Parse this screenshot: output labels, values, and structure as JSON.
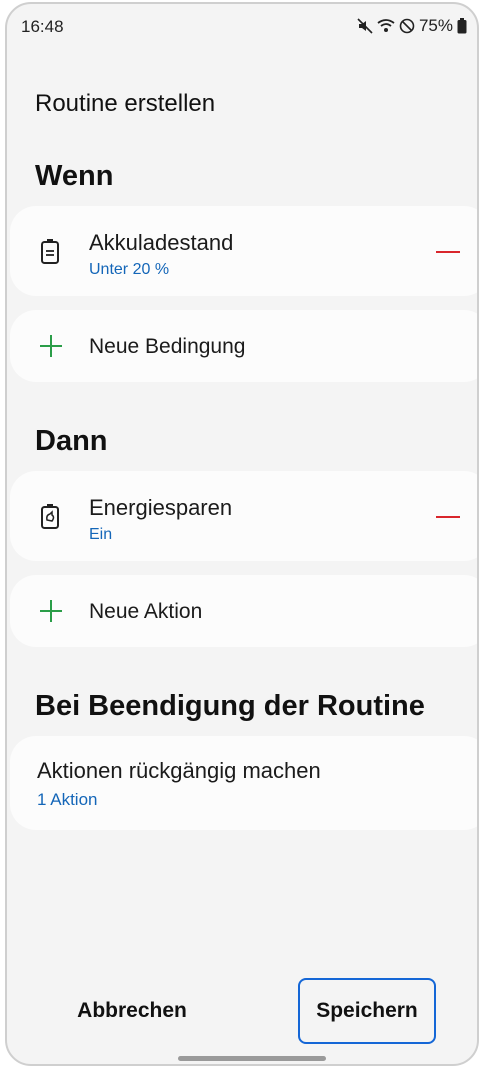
{
  "status": {
    "time": "16:48",
    "battery": "75%",
    "icons": [
      "mute-icon",
      "wifi-icon",
      "dnd-icon",
      "battery-icon"
    ]
  },
  "page_title": "Routine erstellen",
  "if_section": {
    "title": "Wenn",
    "condition": {
      "title": "Akkuladestand",
      "value": "Unter 20 %",
      "icon": "battery-icon"
    },
    "add_label": "Neue Bedingung"
  },
  "then_section": {
    "title": "Dann",
    "action": {
      "title": "Energiesparen",
      "value": "Ein",
      "icon": "power-saving-icon"
    },
    "add_label": "Neue Aktion"
  },
  "end_section": {
    "title": "Bei Beendigung der Routine",
    "item": {
      "title": "Aktionen rückgängig machen",
      "value": "1 Aktion"
    }
  },
  "footer": {
    "cancel_label": "Abbrechen",
    "save_label": "Speichern"
  },
  "colors": {
    "accent_blue": "#1466b8",
    "remove_red": "#d9262c",
    "add_green": "#2a9d48"
  }
}
